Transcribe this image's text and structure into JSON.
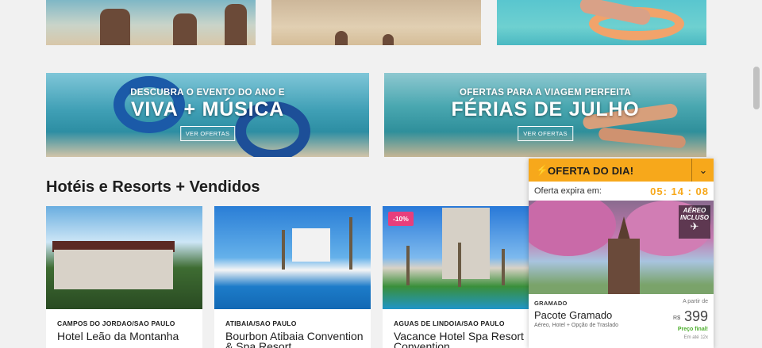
{
  "banners": [
    {
      "small": "DESCUBRA O EVENTO DO ANO E",
      "big": "VIVA + MÚSICA",
      "button": "VER OFERTAS"
    },
    {
      "small": "OFERTAS PARA A VIAGEM PERFEITA",
      "big": "FÉRIAS DE JULHO",
      "button": "VER OFERTAS"
    }
  ],
  "section": {
    "title": "Hotéis e Resorts + Vendidos"
  },
  "hotels": [
    {
      "location": "CAMPOS DO JORDAO/SAO PAULO",
      "name": "Hotel Leão da Montanha",
      "badge": ""
    },
    {
      "location": "ATIBAIA/SAO PAULO",
      "name": "Bourbon Atibaia Convention & Spa Resort",
      "badge": ""
    },
    {
      "location": "AGUAS DE LINDOIA/SAO PAULO",
      "name": "Vacance Hotel Spa Resort Convention",
      "badge": "-10%"
    }
  ],
  "offer": {
    "title": "OFERTA DO DIA!",
    "expire_label": "Oferta expira em:",
    "timer": "05: 14 : 08",
    "aereo_line1": "AÉREO",
    "aereo_line2": "INCLUSO",
    "city": "GRAMADO",
    "package": "Pacote Gramado",
    "description": "Aéreo, Hotel + Opção de Traslado",
    "from_label": "A partir de",
    "currency": "R$",
    "price": "399",
    "final": "Preço final!",
    "installments": "Em até 12x"
  },
  "icons": {
    "bolt": "lightning-icon",
    "chevron": "chevron-down-icon",
    "plane": "airplane-icon"
  },
  "colors": {
    "accent": "#f7a81b",
    "discount": "#e83e7c",
    "final_price": "#4cae2c"
  }
}
